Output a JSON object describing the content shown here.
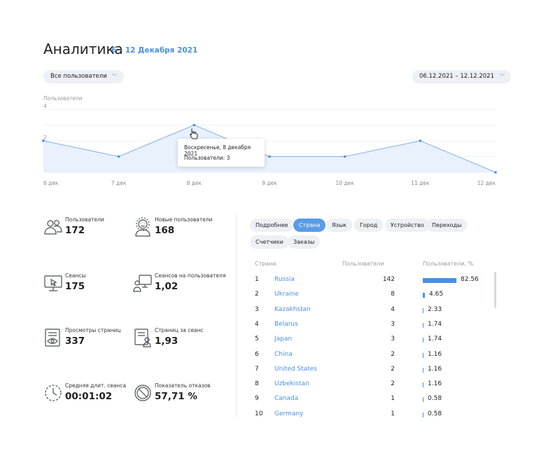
{
  "header": {
    "title": "Аналитика",
    "period": "6 – 12 Декабря 2021"
  },
  "filters": {
    "users_label": "Все пользователи",
    "date_range": "06.12.2021 – 12.12.2021"
  },
  "chart_data": {
    "type": "area",
    "ylabel": "Пользователи",
    "yticks": [
      "4",
      "2"
    ],
    "ylim": [
      0,
      4
    ],
    "categories": [
      "6 дек",
      "7 дек",
      "8 дек",
      "9 дек",
      "10 дек",
      "11 дек",
      "12 дек"
    ],
    "series": [
      {
        "values": [
          2,
          1,
          3,
          1,
          1,
          2,
          0
        ]
      }
    ],
    "grid": true,
    "tooltip": {
      "date": "Воскресенье, 8 декабря 2021",
      "value": "Пользователи: 3"
    }
  },
  "metrics": [
    {
      "label": "Пользователи",
      "value": "172",
      "icon": "users-icon"
    },
    {
      "label": "Новые пользователи",
      "value": "168",
      "icon": "new-user-icon"
    },
    {
      "label": "Сеансы",
      "value": "175",
      "icon": "session-icon"
    },
    {
      "label": "Сеансов на пользователя",
      "value": "1,02",
      "icon": "sessions-per-user-icon"
    },
    {
      "label": "Просмотры страниц",
      "value": "337",
      "icon": "page-views-icon"
    },
    {
      "label": "Страниц за сеанс",
      "value": "1,93",
      "icon": "pages-per-session-icon"
    },
    {
      "label": "Средняя длит. сеанса",
      "value": "00:01:02",
      "icon": "clock-icon"
    },
    {
      "label": "Показатель отказов",
      "value": "57,71 %",
      "icon": "bounce-icon"
    }
  ],
  "tabs": [
    "Подробнее",
    "Страна",
    "Язык",
    "Город",
    "Устройство",
    "Переходы",
    "Счетчики",
    "Заказы"
  ],
  "active_tab": 1,
  "table": {
    "headers": [
      "Страна",
      "Пользователи",
      "Пользователи, %"
    ],
    "rows": [
      {
        "n": "1",
        "country": "Russia",
        "users": "142",
        "pct": "82.56",
        "share": 82.56
      },
      {
        "n": "2",
        "country": "Ukraine",
        "users": "8",
        "pct": "4.65",
        "share": 4.65
      },
      {
        "n": "3",
        "country": "Kazakhstan",
        "users": "4",
        "pct": "2.33",
        "share": 2.33
      },
      {
        "n": "4",
        "country": "Belarus",
        "users": "3",
        "pct": "1.74",
        "share": 1.74
      },
      {
        "n": "5",
        "country": "Japan",
        "users": "3",
        "pct": "1.74",
        "share": 1.74
      },
      {
        "n": "6",
        "country": "China",
        "users": "2",
        "pct": "1.16",
        "share": 1.16
      },
      {
        "n": "7",
        "country": "United States",
        "users": "2",
        "pct": "1.16",
        "share": 1.16
      },
      {
        "n": "8",
        "country": "Uzbekistan",
        "users": "2",
        "pct": "1.16",
        "share": 1.16
      },
      {
        "n": "9",
        "country": "Canada",
        "users": "1",
        "pct": "0.58",
        "share": 0.58
      },
      {
        "n": "10",
        "country": "Germany",
        "users": "1",
        "pct": "0.58",
        "share": 0.58
      }
    ]
  },
  "colors": {
    "accent": "#4a90e2",
    "area_fill": "#e8f1fc",
    "pill_bg": "#edf0f4"
  }
}
